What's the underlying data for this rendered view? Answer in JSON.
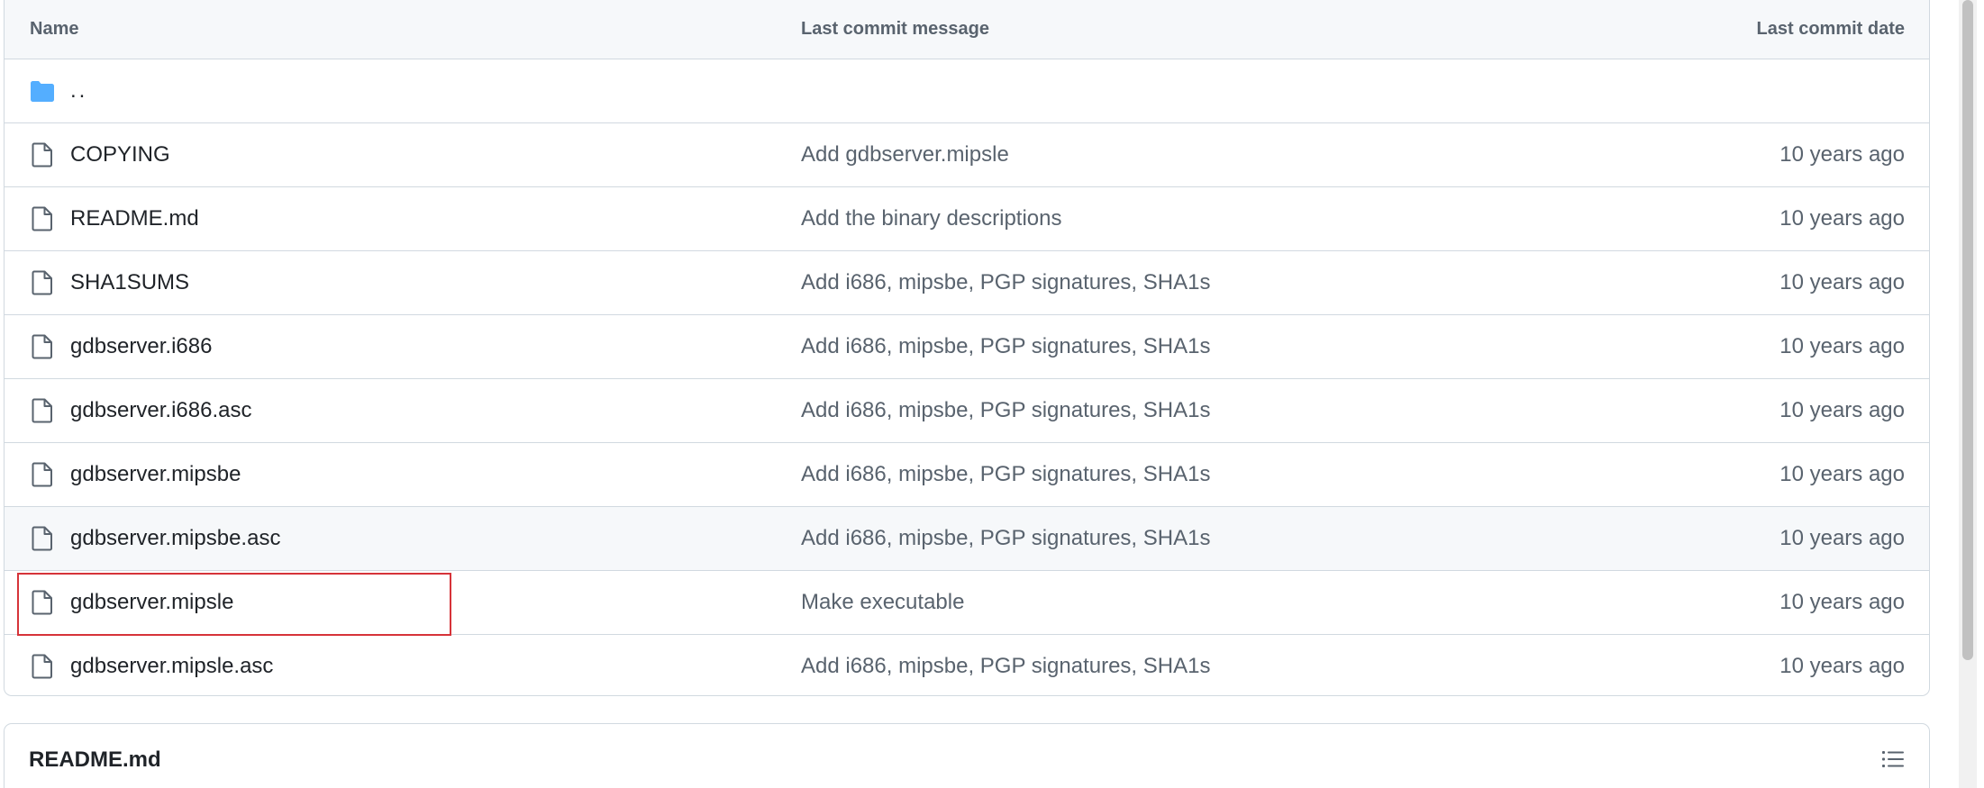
{
  "table": {
    "headers": {
      "name": "Name",
      "message": "Last commit message",
      "date": "Last commit date"
    },
    "parent": {
      "name": "..",
      "icon": "folder-icon"
    },
    "rows": [
      {
        "name": "COPYING",
        "message": "Add gdbserver.mipsle",
        "date": "10 years ago",
        "icon": "file-icon"
      },
      {
        "name": "README.md",
        "message": "Add the binary descriptions",
        "date": "10 years ago",
        "icon": "file-icon"
      },
      {
        "name": "SHA1SUMS",
        "message": "Add i686, mipsbe, PGP signatures, SHA1s",
        "date": "10 years ago",
        "icon": "file-icon"
      },
      {
        "name": "gdbserver.i686",
        "message": "Add i686, mipsbe, PGP signatures, SHA1s",
        "date": "10 years ago",
        "icon": "file-icon"
      },
      {
        "name": "gdbserver.i686.asc",
        "message": "Add i686, mipsbe, PGP signatures, SHA1s",
        "date": "10 years ago",
        "icon": "file-icon"
      },
      {
        "name": "gdbserver.mipsbe",
        "message": "Add i686, mipsbe, PGP signatures, SHA1s",
        "date": "10 years ago",
        "icon": "file-icon"
      },
      {
        "name": "gdbserver.mipsbe.asc",
        "message": "Add i686, mipsbe, PGP signatures, SHA1s",
        "date": "10 years ago",
        "icon": "file-icon"
      },
      {
        "name": "gdbserver.mipsle",
        "message": "Make executable",
        "date": "10 years ago",
        "icon": "file-icon"
      },
      {
        "name": "gdbserver.mipsle.asc",
        "message": "Add i686, mipsbe, PGP signatures, SHA1s",
        "date": "10 years ago",
        "icon": "file-icon"
      }
    ]
  },
  "readme": {
    "title": "README.md",
    "icon": "table-of-contents-icon"
  },
  "colors": {
    "folder": "#54aeff",
    "border": "#d1d9e0",
    "header_bg": "#f6f8fa",
    "highlight": "#d63339",
    "muted_text": "#59636e"
  }
}
